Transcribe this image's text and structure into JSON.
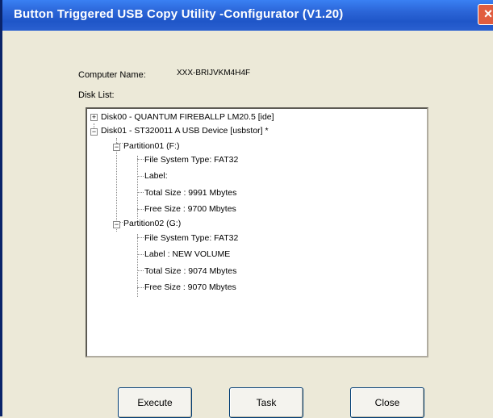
{
  "window": {
    "title": "Button Triggered USB Copy Utility -Configurator (V1.20)",
    "close_glyph": "×"
  },
  "form": {
    "computer_name_label": "Computer Name:",
    "computer_name_value": "XXX-BRIJVKM4H4F",
    "disk_list_label": "Disk List:"
  },
  "tree": {
    "disk00": {
      "label": "Disk00 - QUANTUM FIREBALLP LM20.5 [ide]",
      "expander": "+"
    },
    "disk01": {
      "label": "Disk01 - ST320011 A USB Device [usbstor] *",
      "expander": "−"
    },
    "partition01": {
      "label": "Partition01 (F:)",
      "expander": "−",
      "props": [
        "File System Type: FAT32",
        "Label:",
        "Total Size : 9991 Mbytes",
        "Free Size : 9700 Mbytes"
      ]
    },
    "partition02": {
      "label": "Partition02 (G:)",
      "expander": "−",
      "props": [
        "File System Type: FAT32",
        "Label : NEW VOLUME",
        "Total Size : 9074 Mbytes",
        "Free Size : 9070 Mbytes"
      ]
    }
  },
  "buttons": {
    "execute": "Execute",
    "task": "Task",
    "close": "Close"
  },
  "colors": {
    "titlebar": "#2a64d6",
    "window_bg": "#ece9d8",
    "close_button": "#e15d3f"
  }
}
